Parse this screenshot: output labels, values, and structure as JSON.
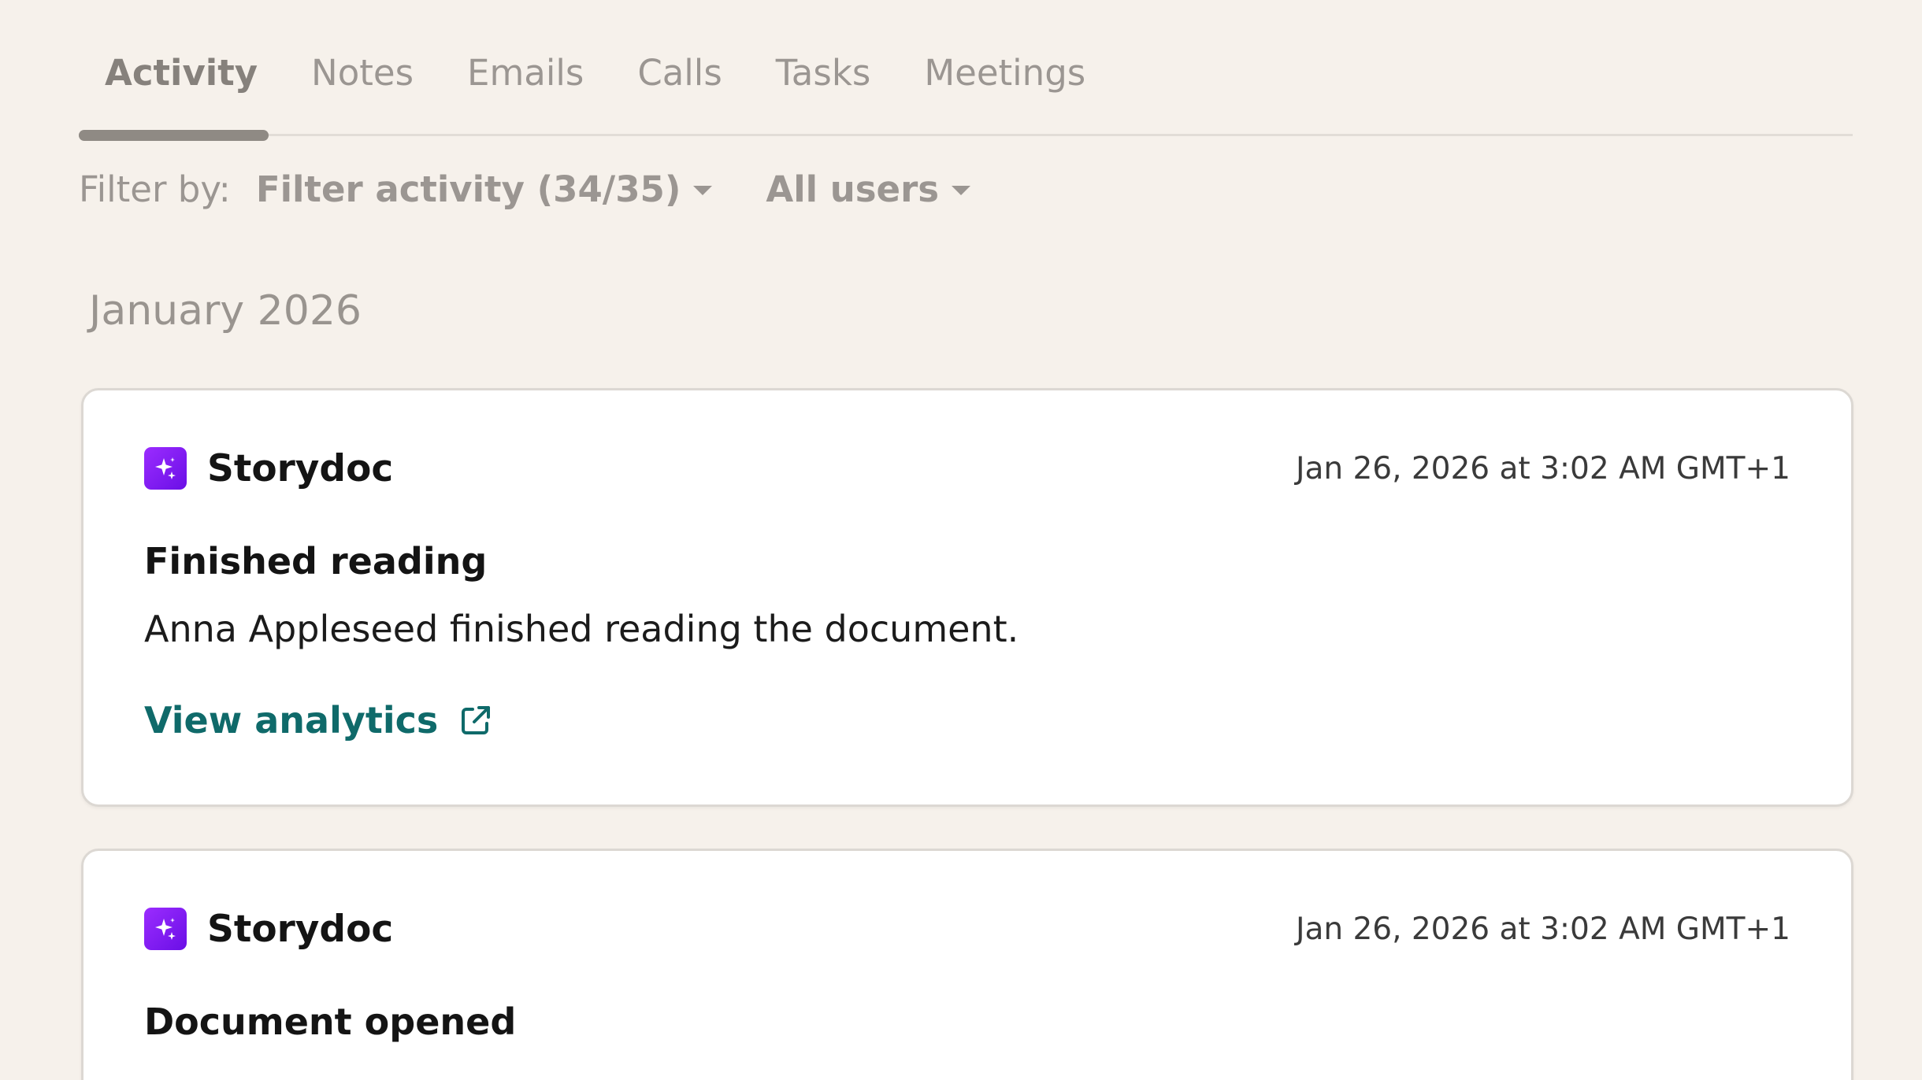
{
  "tabs": [
    {
      "label": "Activity",
      "active": true
    },
    {
      "label": "Notes",
      "active": false
    },
    {
      "label": "Emails",
      "active": false
    },
    {
      "label": "Calls",
      "active": false
    },
    {
      "label": "Tasks",
      "active": false
    },
    {
      "label": "Meetings",
      "active": false
    }
  ],
  "filters": {
    "label": "Filter by:",
    "activity": "Filter activity (34/35)",
    "users": "All users"
  },
  "month": "January 2026",
  "colors": {
    "brand_icon": "#7a14f0",
    "link": "#0f6a6a",
    "background": "#f6f1eb"
  },
  "cards": [
    {
      "app": "Storydoc",
      "icon": "sparkle-icon",
      "timestamp": "Jan 26, 2026 at 3:02 AM GMT+1",
      "title": "Finished reading",
      "body": "Anna Appleseed finished reading the document.",
      "link": "View analytics",
      "link_icon": "external-link-icon"
    },
    {
      "app": "Storydoc",
      "icon": "sparkle-icon",
      "timestamp": "Jan 26, 2026 at 3:02 AM GMT+1",
      "title": "Document opened"
    }
  ]
}
